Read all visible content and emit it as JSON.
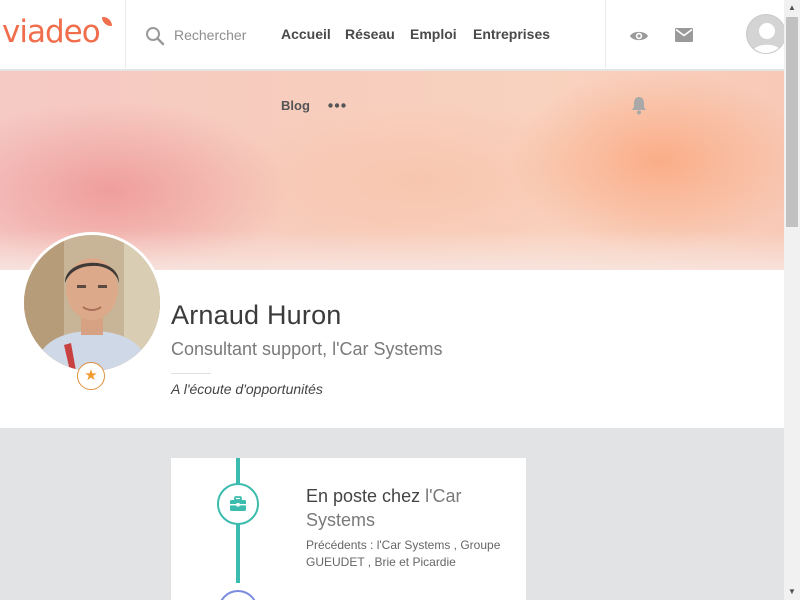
{
  "header": {
    "logo_text": "viadeo",
    "search_placeholder": "Rechercher",
    "nav": [
      "Accueil",
      "Réseau",
      "Emploi",
      "Entreprises"
    ],
    "icons": [
      "search-icon",
      "eye-icon",
      "mail-icon",
      "avatar"
    ]
  },
  "banner": {
    "blog_label": "Blog",
    "more_icon": "more-icon",
    "bell_icon": "bell-icon"
  },
  "profile": {
    "name": "Arnaud Huron",
    "headline": "Consultant support, l'Car Systems",
    "status": "A l'écoute d'opportunités",
    "badge_icon": "star-icon"
  },
  "timeline": {
    "title_prefix": "En poste chez",
    "company": "l'Car Systems",
    "previous": "Précédents : l'Car Systems , Groupe GUEUDET , Brie et Picardie",
    "icon": "briefcase-icon"
  },
  "colors": {
    "brand": "#f06e4c",
    "teal": "#3cbcae",
    "star": "#f09a30"
  }
}
